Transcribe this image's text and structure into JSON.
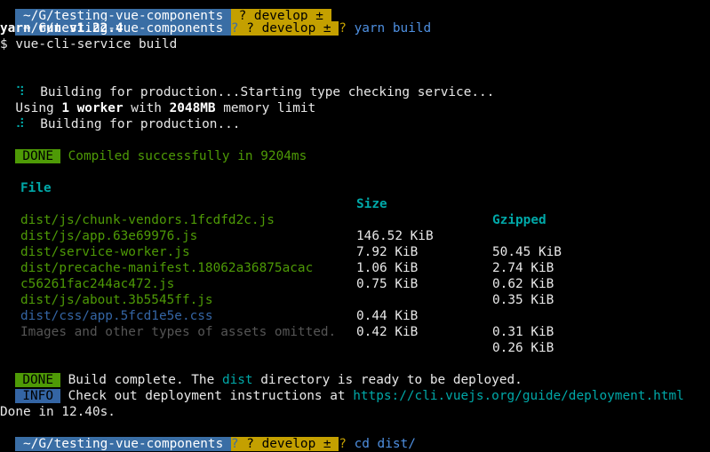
{
  "prompt_top": {
    "prev_path": " ~/G/testing-vue-components ",
    "prev_branch": " ? develop ± "
  },
  "prompt1": {
    "path": " ~/G/testing-vue-components ",
    "arrow1": "?",
    "branch": " ? develop ± ",
    "arrow2": "?",
    "command": " yarn build"
  },
  "yarn_run": "yarn run v1.22.4",
  "service_cmd": "$ vue-cli-service build",
  "building_line1": {
    "spinner": "⠹",
    "text": "  Building for production...Starting type checking service..."
  },
  "worker_line": {
    "pre": "Using ",
    "count": "1 worker",
    "mid": " with ",
    "mem": "2048MB",
    "post": " memory limit"
  },
  "building_line2": {
    "spinner": "⠼",
    "text": "  Building for production..."
  },
  "compiled": {
    "badge": "DONE",
    "text": " Compiled successfully in 9204ms"
  },
  "table": {
    "headers": {
      "file": "File",
      "size": "Size",
      "gzipped": "Gzipped"
    },
    "rows": [
      {
        "file": "dist/js/chunk-vendors.1fcdfd2c.js",
        "size": "146.52 KiB",
        "gzip": "50.45 KiB"
      },
      {
        "file": "dist/js/app.63e69976.js",
        "size": "7.92 KiB",
        "gzip": "2.74 KiB"
      },
      {
        "file": "dist/service-worker.js",
        "size": "1.06 KiB",
        "gzip": "0.62 KiB"
      },
      {
        "file": "dist/precache-manifest.18062a36875acac",
        "file_cont": "c56261fac244ac472.js",
        "size": "0.75 KiB",
        "gzip": "0.35 KiB"
      },
      {
        "file": "dist/js/about.3b5545ff.js",
        "size": "0.44 KiB",
        "gzip": "0.31 KiB"
      },
      {
        "file": "dist/css/app.5fcd1e5e.css",
        "size": "0.42 KiB",
        "gzip": "0.26 KiB"
      }
    ]
  },
  "omitted": "Images and other types of assets omitted.",
  "build_complete": {
    "badge": "DONE",
    "pre": " Build complete. The ",
    "dist": "dist",
    "post": " directory is ready to be deployed."
  },
  "info": {
    "badge": "INFO",
    "pre": " Check out deployment instructions at ",
    "url": "https://cli.vuejs.org/guide/deployment.html"
  },
  "done_line": "Done in 12.40s.",
  "prompt2": {
    "path": " ~/G/testing-vue-components ",
    "arrow1": "?",
    "branch": " ? develop ± ",
    "arrow2": "?",
    "command": " cd dist/"
  },
  "colors": {
    "background": "#000000",
    "prompt_path_bg": "#3a6ea5",
    "prompt_branch_bg": "#c4a000",
    "done_badge": "#4e9a06",
    "info_badge": "#3465a4",
    "js_file": "#4e9a06",
    "css_file": "#3465a4",
    "header": "#00a8a8"
  }
}
